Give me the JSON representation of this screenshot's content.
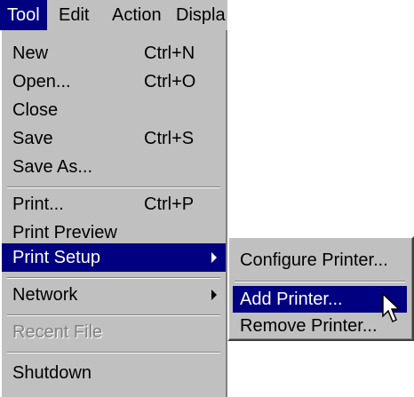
{
  "menubar": {
    "items": [
      "Tool",
      "Edit",
      "Action",
      "Displa"
    ]
  },
  "tool_menu": {
    "items": [
      {
        "label": "New",
        "shortcut": "Ctrl+N"
      },
      {
        "label": "Open...",
        "shortcut": "Ctrl+O"
      },
      {
        "label": "Close",
        "shortcut": ""
      },
      {
        "label": "Save",
        "shortcut": "Ctrl+S"
      },
      {
        "label": "Save As...",
        "shortcut": ""
      },
      {
        "label": "Print...",
        "shortcut": "Ctrl+P"
      },
      {
        "label": "Print Preview",
        "shortcut": ""
      },
      {
        "label": "Print Setup",
        "shortcut": ""
      },
      {
        "label": "Network",
        "shortcut": ""
      },
      {
        "label": "Recent File",
        "shortcut": ""
      },
      {
        "label": "Shutdown",
        "shortcut": ""
      }
    ]
  },
  "print_setup_submenu": {
    "items": [
      "Configure Printer...",
      "Add Printer...",
      "Remove Printer..."
    ]
  },
  "colors": {
    "menu_bg": "#c0c0c0",
    "highlight": "#000080",
    "disabled_text": "#808080"
  },
  "icons": {
    "cursor": "arrow-cursor-icon",
    "submenu_arrow": "chevron-right-icon"
  }
}
